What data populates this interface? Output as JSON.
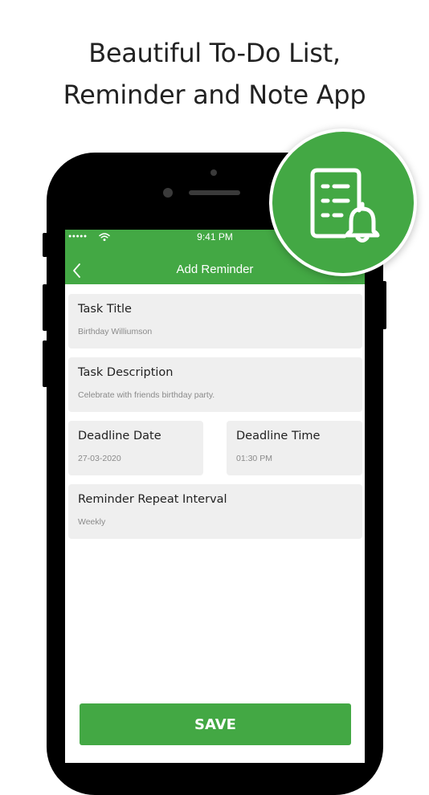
{
  "headline": {
    "line1": "Beautiful To-Do List,",
    "line2": "Reminder and Note App"
  },
  "status_bar": {
    "signal": "●●●●●",
    "time": "9:41 PM"
  },
  "nav": {
    "title": "Add Reminder"
  },
  "form": {
    "task_title": {
      "label": "Task Title",
      "value": "Birthday Williumson"
    },
    "task_description": {
      "label": "Task Description",
      "value": "Celebrate with friends birthday party."
    },
    "deadline_date": {
      "label": "Deadline Date",
      "value": "27-03-2020"
    },
    "deadline_time": {
      "label": "Deadline Time",
      "value": "01:30 PM"
    },
    "repeat_interval": {
      "label": "Reminder Repeat Interval",
      "value": "Weekly"
    }
  },
  "save_label": "SAVE",
  "colors": {
    "accent": "#43a844",
    "card_background": "#efefef",
    "phone_frame": "#000000"
  },
  "icons": {
    "badge": "reminder-list-bell-icon",
    "back": "chevron-left-icon",
    "wifi": "wifi-icon"
  }
}
